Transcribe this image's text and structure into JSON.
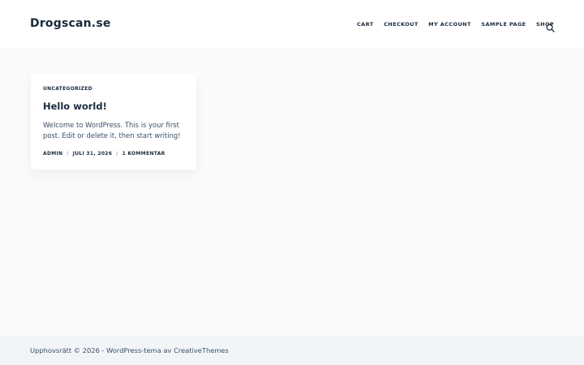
{
  "header": {
    "site_title": "Drogscan.se",
    "nav": [
      "CART",
      "CHECKOUT",
      "MY ACCOUNT",
      "SAMPLE PAGE",
      "SHOP"
    ],
    "search_icon": "search-icon"
  },
  "post": {
    "category": "UNCATEGORIZED",
    "title": "Hello world!",
    "excerpt": "Welcome to WordPress. This is your first post. Edit or delete it, then start writing!",
    "meta": {
      "author": "ADMIN",
      "separator": "/",
      "date": "JULI 31, 2026",
      "comments": "1 KOMMENTAR"
    }
  },
  "footer": {
    "copyright_prefix": "Upphovsrätt © 2026 - ",
    "theme_link": "WordPress-tema",
    "by": " av ",
    "author_link": "CreativeThemes"
  },
  "colors": {
    "heading": "#192a3d",
    "text": "#3a4f66",
    "page_bg": "#f9fafb",
    "footer_bg": "#f2f5f7"
  }
}
